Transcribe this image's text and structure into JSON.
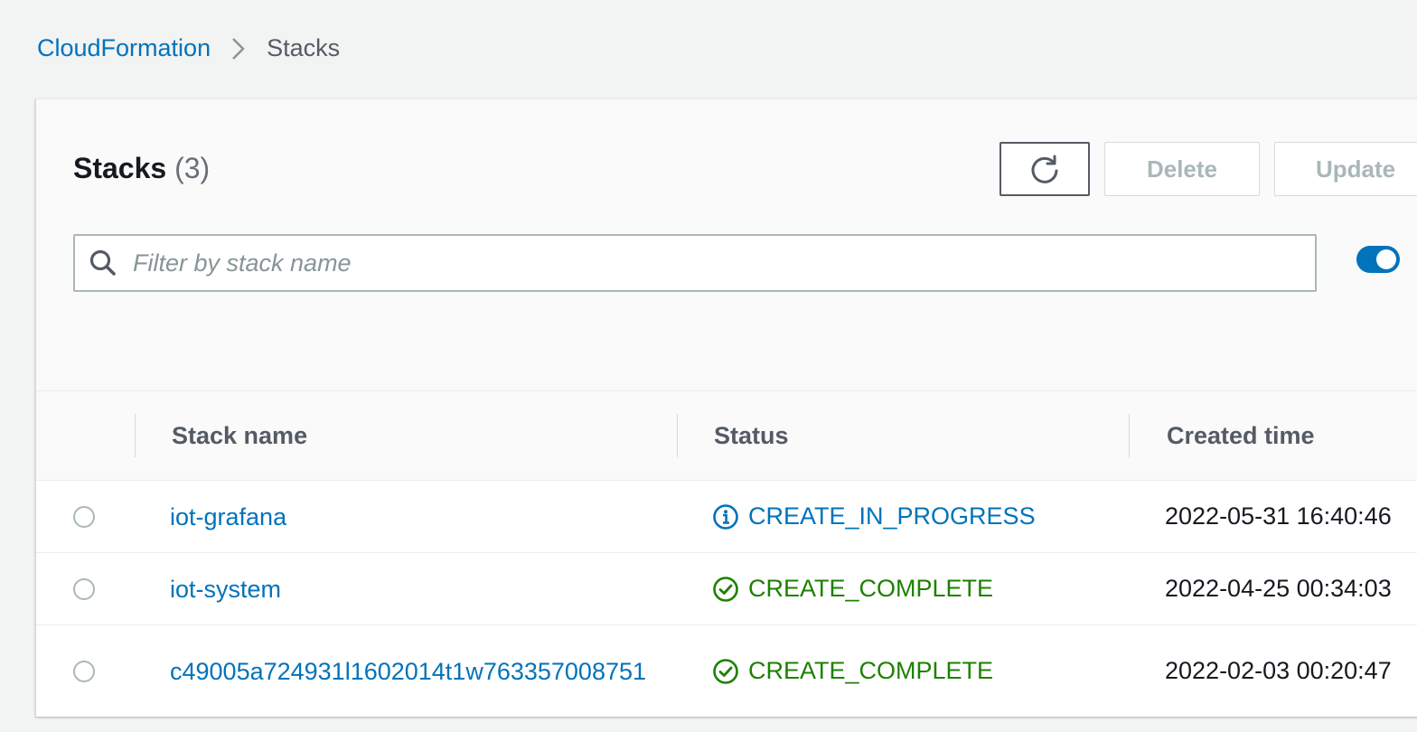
{
  "breadcrumb": {
    "parent": "CloudFormation",
    "current": "Stacks"
  },
  "panel": {
    "title": "Stacks",
    "count": "(3)"
  },
  "toolbar": {
    "refresh_icon": "refresh-icon",
    "delete_label": "Delete",
    "update_label": "Update"
  },
  "search": {
    "placeholder": "Filter by stack name",
    "value": ""
  },
  "toggle": {
    "state": "on"
  },
  "table": {
    "columns": [
      "Stack name",
      "Status",
      "Created time"
    ],
    "rows": [
      {
        "name": "iot-grafana",
        "status": "CREATE_IN_PROGRESS",
        "status_icon": "info-icon",
        "created": "2022-05-31 16:40:46"
      },
      {
        "name": "iot-system",
        "status": "CREATE_COMPLETE",
        "status_icon": "check-circle-icon",
        "created": "2022-04-25 00:34:03"
      },
      {
        "name": "c49005a724931l1602014t1w763357008751",
        "status": "CREATE_COMPLETE",
        "status_icon": "check-circle-icon",
        "created": "2022-02-03 00:20:47"
      }
    ]
  },
  "colors": {
    "link": "#0073bb",
    "in_progress": "#0073bb",
    "complete": "#1d8102",
    "toggle_on": "#0073bb"
  }
}
